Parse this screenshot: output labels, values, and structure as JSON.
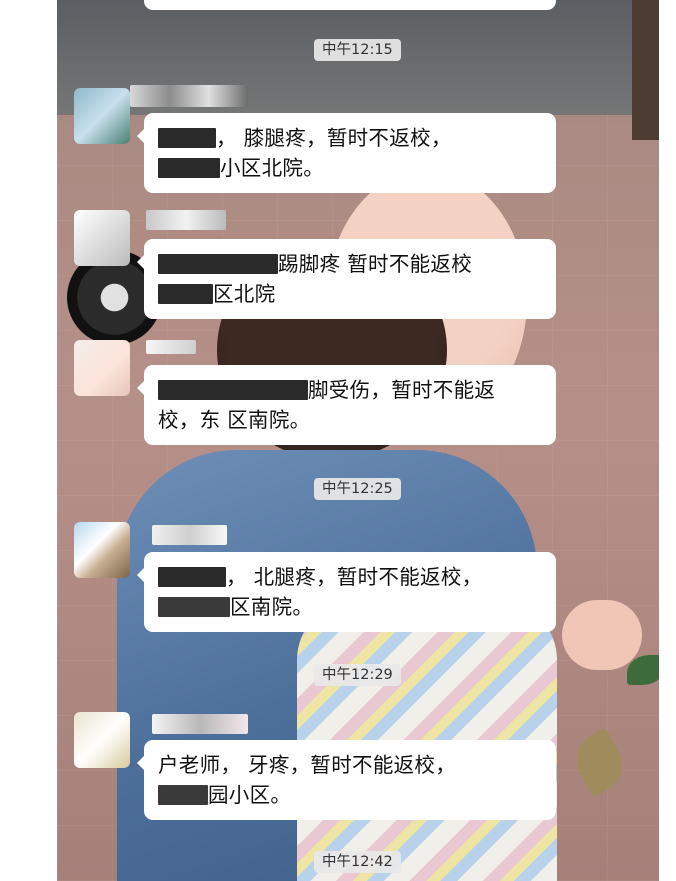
{
  "chat": {
    "times": [
      "中午12:15",
      "中午12:25",
      "中午12:29",
      "中午12:42"
    ],
    "messages": [
      {
        "line1": "，    膝腿疼，暂时不返校，",
        "line2": "小区北院。"
      },
      {
        "line1": "踢脚疼  暂时不能返校",
        "line2": "区北院"
      },
      {
        "line1": "脚受伤，暂时不能返",
        "line2": "校，东     区南院。"
      },
      {
        "line1": "，    北腿疼，暂时不能返校，",
        "line2": "区南院。"
      },
      {
        "line1": "户老师，      牙疼，暂时不能返校，",
        "line2": "园小区。"
      }
    ]
  },
  "colors": {
    "bubble": "#ffffff",
    "time_pill": "#e8e8e8",
    "text": "#111111"
  }
}
